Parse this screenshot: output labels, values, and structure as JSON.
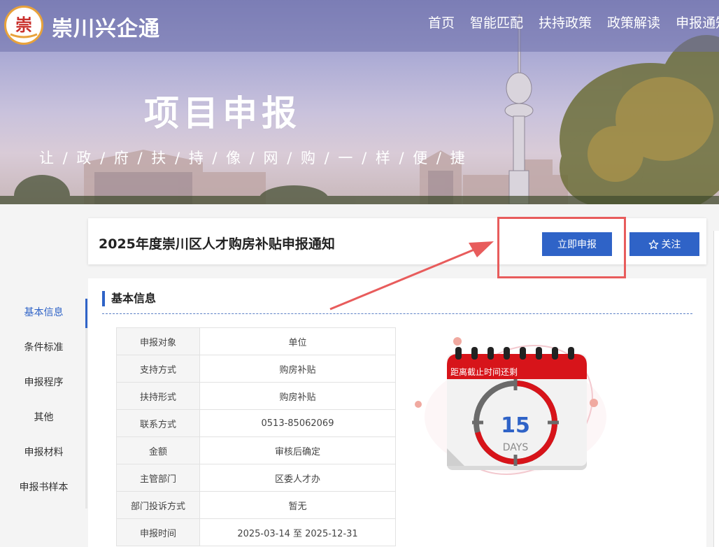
{
  "brand": {
    "name": "崇川兴企通",
    "logo_glyph": "崇"
  },
  "nav": {
    "items": [
      "首页",
      "智能匹配",
      "扶持政策",
      "政策解读",
      "申报通知"
    ]
  },
  "hero": {
    "title": "项目申报",
    "slogan": "让 / 政 / 府 / 扶 / 持 / 像 / 网 / 购 / 一 / 样 / 便 / 捷"
  },
  "sidebar": {
    "items": [
      "基本信息",
      "条件标准",
      "申报程序",
      "其他",
      "申报材料",
      "申报书样本"
    ],
    "active_index": 0
  },
  "notice": {
    "title": "2025年度崇川区人才购房补贴申报通知",
    "apply_label": "立即申报",
    "follow_label": "关注"
  },
  "section": {
    "title": "基本信息"
  },
  "info_rows": [
    {
      "key": "申报对象",
      "value": "单位"
    },
    {
      "key": "支持方式",
      "value": "购房补贴"
    },
    {
      "key": "扶持形式",
      "value": "购房补贴"
    },
    {
      "key": "联系方式",
      "value": "0513-85062069"
    },
    {
      "key": "金额",
      "value": "审核后确定"
    },
    {
      "key": "主管部门",
      "value": "区委人才办"
    },
    {
      "key": "部门投诉方式",
      "value": "暂无"
    },
    {
      "key": "申报时间",
      "value": "2025-03-14 至 2025-12-31"
    }
  ],
  "countdown": {
    "label": "距离截止时间还剩",
    "days": "15",
    "unit": "DAYS"
  },
  "colors": {
    "primary": "#2f63c7",
    "annotation": "#e85c5c",
    "calendar_red": "#d7141a"
  }
}
